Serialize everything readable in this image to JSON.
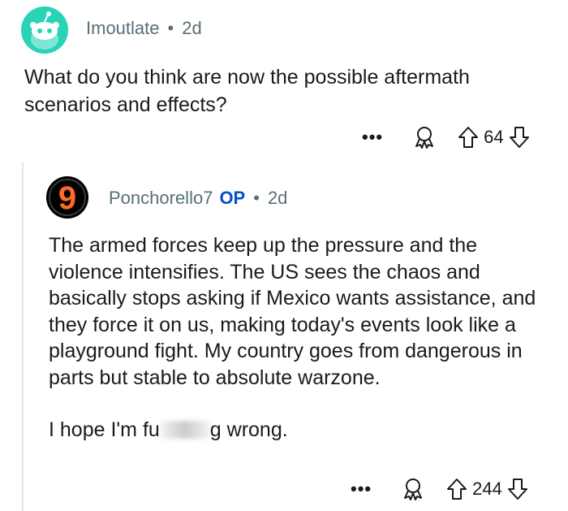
{
  "top_comment": {
    "username": "Imoutlate",
    "separator": "•",
    "time": "2d",
    "body": "What do you think are now the possible aftermath scenarios and effects?",
    "more_label": "•••",
    "score": "64",
    "avatar_color": "#2ad3b6"
  },
  "reply": {
    "username": "Ponchorello7",
    "badge": "OP",
    "separator": "•",
    "time": "2d",
    "avatar_glyph": "9",
    "avatar_glyph_color": "#ff6a2a",
    "paragraph_1": "The armed forces keep up the pressure and the violence intensifies. The US sees the chaos and basically stops asking if Mexico wants assistance, and they force it on us, making today's events look like a playground fight. My country goes from dangerous in parts but stable to absolute warzone.",
    "paragraph_2_start": "I hope I'm fu",
    "paragraph_2_end": "g wrong.",
    "more_label": "•••",
    "score": "244"
  },
  "colors": {
    "meta_text": "#576f76",
    "op_badge": "#0a4ec2",
    "body_text": "#1a1a1b"
  }
}
